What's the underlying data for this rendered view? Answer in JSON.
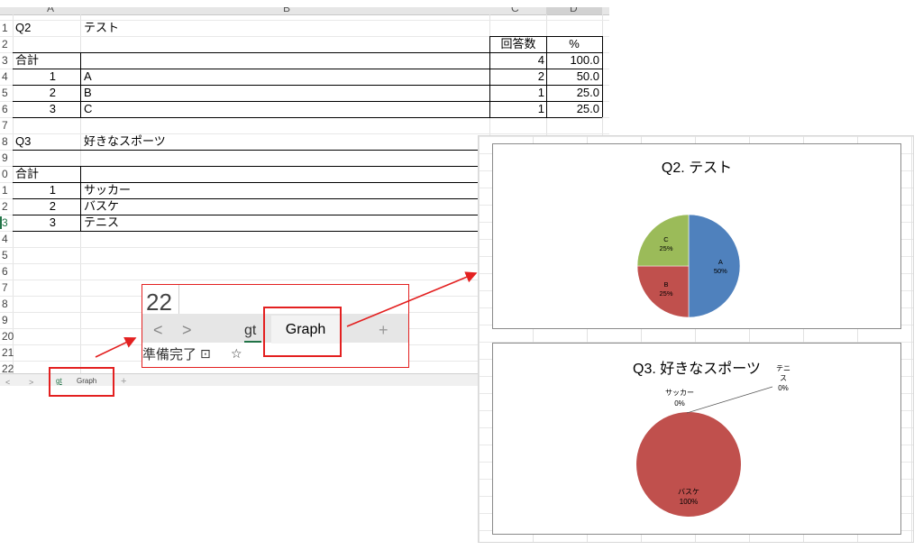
{
  "sheet": {
    "col_headers": [
      "A",
      "B",
      "C",
      "D"
    ],
    "row_numbers": [
      "1",
      "2",
      "3",
      "4",
      "5",
      "6",
      "7",
      "8",
      "9",
      "0",
      "1",
      "2",
      "3",
      "4",
      "5",
      "6",
      "7",
      "8",
      "9",
      "20",
      "21",
      "22"
    ],
    "rows": [
      {
        "a": "Q2",
        "b": "テスト",
        "c": "",
        "d": ""
      },
      {
        "a": "",
        "b": "",
        "c": "回答数",
        "d": "%"
      },
      {
        "a": "合計",
        "b": "",
        "c": "4",
        "d": "100.0"
      },
      {
        "a": "1",
        "b": "A",
        "c": "2",
        "d": "50.0"
      },
      {
        "a": "2",
        "b": "B",
        "c": "1",
        "d": "25.0"
      },
      {
        "a": "3",
        "b": "C",
        "c": "1",
        "d": "25.0"
      },
      {
        "a": "",
        "b": "",
        "c": "",
        "d": ""
      },
      {
        "a": "Q3",
        "b": "好きなスポーツ",
        "c": "",
        "d": ""
      },
      {
        "a": "",
        "b": "",
        "c": "",
        "d": ""
      },
      {
        "a": "合計",
        "b": "",
        "c": "",
        "d": ""
      },
      {
        "a": "1",
        "b": "サッカー",
        "c": "",
        "d": ""
      },
      {
        "a": "2",
        "b": "バスケ",
        "c": "",
        "d": ""
      },
      {
        "a": "3",
        "b": "テニス",
        "c": "",
        "d": ""
      }
    ]
  },
  "tabbar": {
    "prev": "<",
    "next": ">",
    "tab_gt": "gt",
    "tab_graph": "Graph",
    "add": "+"
  },
  "zoom": {
    "cell_value": "22",
    "prev": "<",
    "next": ">",
    "tab_gt": "gt",
    "tab_graph": "Graph",
    "add": "+",
    "status": "準備完了",
    "icon_macro": "⊡",
    "icon_accessibility": "☆"
  },
  "chart_data": [
    {
      "type": "pie",
      "title": "Q2. テスト",
      "categories": [
        "A",
        "B",
        "C"
      ],
      "values": [
        50,
        25,
        25
      ],
      "labels": [
        "50%",
        "25%",
        "25%"
      ],
      "colors": [
        "#4f81bd",
        "#c0504d",
        "#9bbb59"
      ]
    },
    {
      "type": "pie",
      "title": "Q3. 好きなスポーツ",
      "categories": [
        "サッカー",
        "バスケ",
        "テニス"
      ],
      "values": [
        0,
        100,
        0
      ],
      "labels": [
        "0%",
        "100%",
        "0%"
      ],
      "label_lines": [
        "テニ",
        "ス"
      ],
      "colors": [
        "#4f81bd",
        "#c0504d",
        "#9bbb59"
      ]
    }
  ],
  "colors": {
    "accent": "#217346",
    "callout": "#e32020"
  }
}
